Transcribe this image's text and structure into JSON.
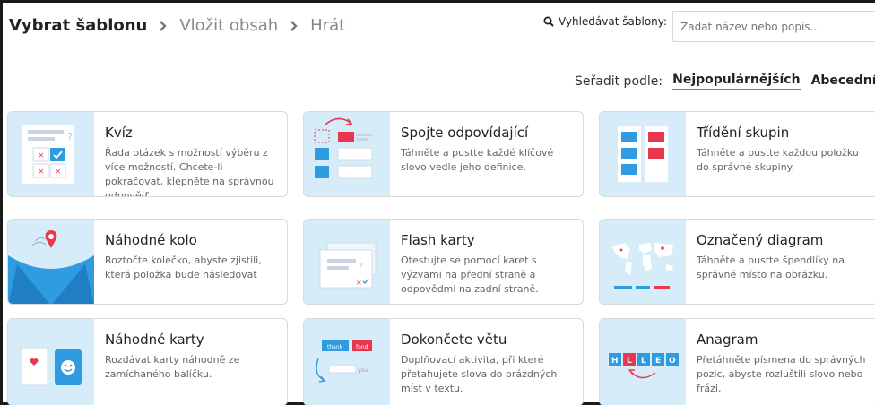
{
  "breadcrumb": {
    "steps": [
      "Vybrat šablonu",
      "Vložit obsah",
      "Hrát"
    ]
  },
  "search": {
    "label": "Vyhledávat šablony:",
    "placeholder": "Zadat název nebo popis..."
  },
  "sort": {
    "label": "Seřadit podle:",
    "options": [
      "Nejpopulárnějších",
      "Abecední"
    ],
    "selected": "Nejpopulárnějších"
  },
  "colors": {
    "accent": "#2b8bd6",
    "thumb_bg": "#d6ecf9",
    "blue": "#2f9be0",
    "red": "#e8384f"
  },
  "templates": [
    {
      "title": "Kvíz",
      "description": "Řada otázek s možností výběru z více možností. Chcete-li pokračovat, klepněte na správnou odpověď.",
      "icon": "quiz-icon"
    },
    {
      "title": "Spojte odpovídající",
      "description": "Táhněte a pustte každé klíčové slovo vedle jeho definice.",
      "icon": "match-up-icon"
    },
    {
      "title": "Třídění skupin",
      "description": "Táhněte a pustte každou položku do správné skupiny.",
      "icon": "group-sort-icon"
    },
    {
      "title": "Náhodné kolo",
      "description": "Roztočte kolečko, abyste zjistili, která položka bude následovat",
      "icon": "spin-wheel-icon"
    },
    {
      "title": "Flash karty",
      "description": "Otestujte se pomocí karet s výzvami na přední straně a odpovědmi na zadní straně.",
      "icon": "flash-cards-icon"
    },
    {
      "title": "Označený diagram",
      "description": "Táhněte a pustte špendlíky na správné místo na obrázku.",
      "icon": "labelled-diagram-icon"
    },
    {
      "title": "Náhodné karty",
      "description": "Rozdávat karty náhodně ze zamíchaného balíčku.",
      "icon": "random-cards-icon"
    },
    {
      "title": "Dokončete větu",
      "description": "Doplňovací aktivita, při které přetahujete slova do prázdných míst v textu.",
      "icon": "complete-sentence-icon",
      "thumb_labels": [
        "thank",
        "fond",
        "you"
      ]
    },
    {
      "title": "Anagram",
      "description": "Přetáhněte písmena do správných pozic, abyste rozluštili slovo nebo frázi.",
      "icon": "anagram-icon",
      "thumb_letters": [
        "H",
        "L",
        "L",
        "E",
        "O"
      ]
    }
  ]
}
